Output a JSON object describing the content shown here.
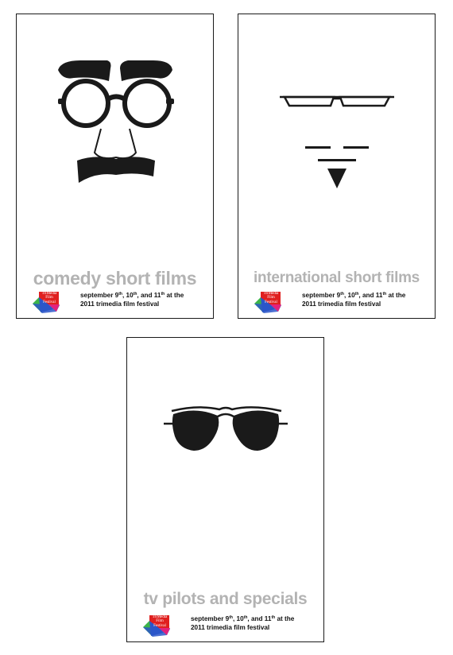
{
  "colors": {
    "ink": "#1a1a1a",
    "title_gray": "#b3b3b3",
    "logo_red": "#e0201f",
    "logo_blue": "#2b56c9",
    "logo_green": "#3cb44a",
    "logo_magenta": "#e2227c"
  },
  "logo": {
    "line1": "TriMedia",
    "line2": "Film",
    "line3": "Festival"
  },
  "dates": {
    "prefix": "september 9",
    "ord1": "th",
    "sep1": ", 10",
    "ord2": "th",
    "sep2": ", and 11",
    "ord3": "th",
    "suffix": " at the",
    "line2": "2011 trimedia film festival"
  },
  "posters": [
    {
      "title": "comedy short films",
      "icon": "groucho-glasses-icon"
    },
    {
      "title": "international short films",
      "icon": "minimal-face-icon"
    },
    {
      "title": "tv pilots and specials",
      "icon": "aviator-sunglasses-icon"
    }
  ]
}
